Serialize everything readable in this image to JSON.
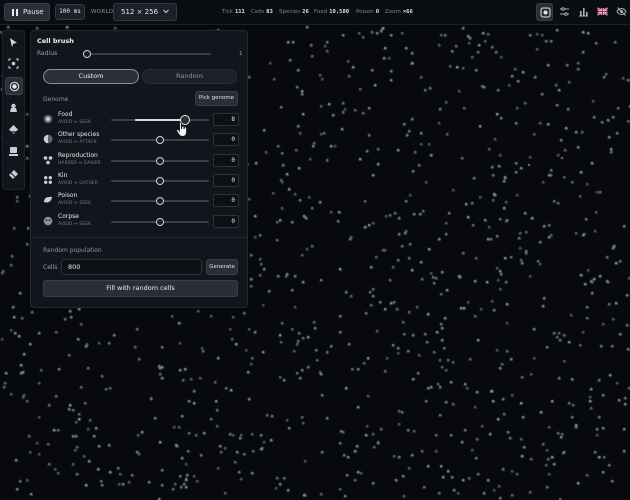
{
  "toolbar": {
    "pause_label": "Pause",
    "speed": "100 ms",
    "world_label": "WORLD",
    "world_size": "512 × 256",
    "stats": [
      {
        "label": "Tick",
        "value": "111"
      },
      {
        "label": "Cells",
        "value": "83"
      },
      {
        "label": "Species",
        "value": "26"
      },
      {
        "label": "Food",
        "value": "10,580"
      },
      {
        "label": "Poison",
        "value": "0"
      },
      {
        "label": "Zoom",
        "value": "×66"
      }
    ],
    "right_icons": [
      "focus-icon",
      "sliders-icon",
      "chart-icon",
      "flag-icon",
      "eye-off-icon"
    ]
  },
  "tools": [
    "pointer-icon",
    "select-icon",
    "cell-brush-icon",
    "food-brush-icon",
    "poison-brush-icon",
    "spawner-icon",
    "eraser-icon"
  ],
  "brush": {
    "title": "Cell brush",
    "radius_label": "Radius",
    "radius_value": "1",
    "radius_fraction": 0.0,
    "tabs": {
      "custom": "Custom",
      "random": "Random"
    },
    "genome_label": "Genome",
    "pick_genome": "Pick genome",
    "genes": [
      {
        "name": "Food",
        "sub": "AVOID ↔ SEEK",
        "value": "8",
        "fraction": 0.76,
        "icon": "food-gene-icon"
      },
      {
        "name": "Other species",
        "sub": "AVOID ↔ ATTACK",
        "value": "0",
        "fraction": 0.5,
        "icon": "species-gene-icon"
      },
      {
        "name": "Reproduction",
        "sub": "HARDER ↔ EASIER",
        "value": "0",
        "fraction": 0.5,
        "icon": "reproduction-gene-icon"
      },
      {
        "name": "Kin",
        "sub": "AVOID ↔ GATHER",
        "value": "0",
        "fraction": 0.5,
        "icon": "kin-gene-icon"
      },
      {
        "name": "Poison",
        "sub": "AVOID ↔ SEEK",
        "value": "0",
        "fraction": 0.5,
        "icon": "poison-gene-icon"
      },
      {
        "name": "Corpse",
        "sub": "AVOID ↔ SEEK",
        "value": "0",
        "fraction": 0.5,
        "icon": "corpse-gene-icon"
      }
    ]
  },
  "random_population": {
    "label": "Random population",
    "cells_label": "Cells",
    "cells_value": "800",
    "generate": "Generate",
    "fill": "Fill with random cells"
  },
  "colors": {
    "background": "#07090d",
    "cell": "#7d9a8b",
    "species_highlight": "#c04fc0",
    "panel": "#12161c"
  }
}
